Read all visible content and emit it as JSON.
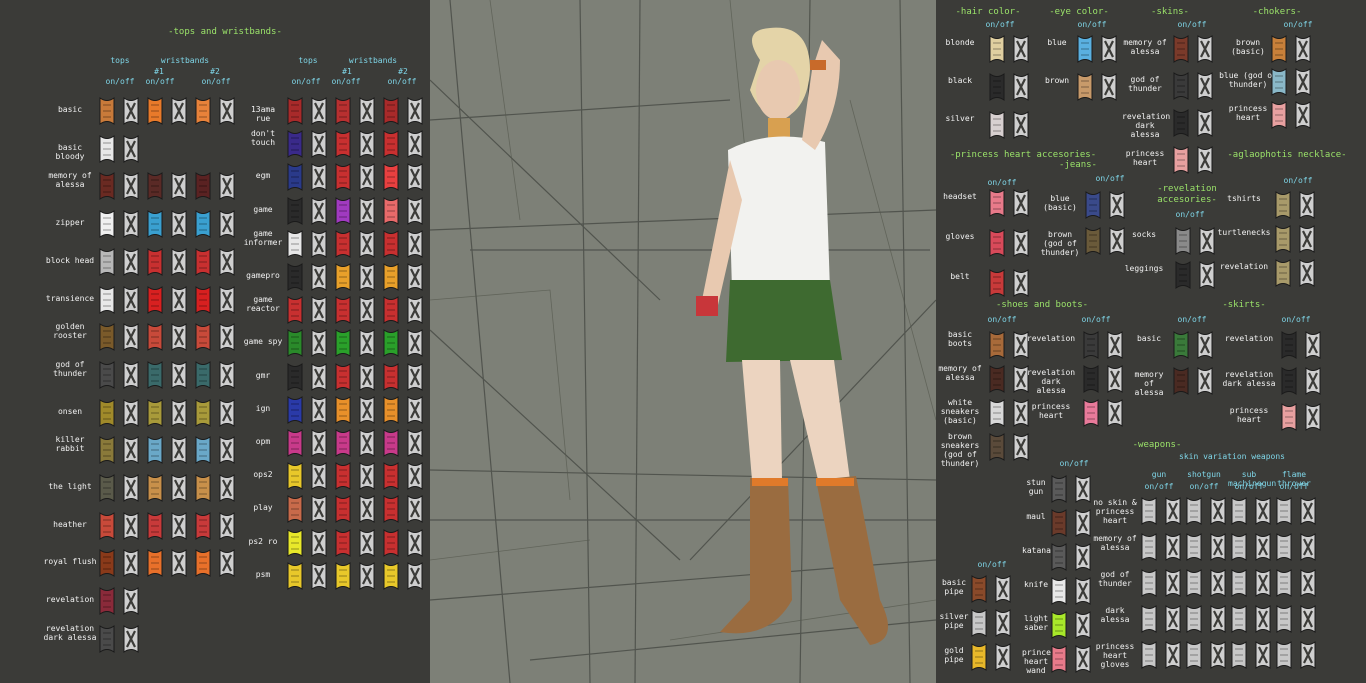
{
  "colors": {
    "panel_bg": "#3b3b38",
    "section_title": "#9be36a",
    "toggle_label": "#7fd6e8",
    "label_text": "#f2f2f2",
    "off_icon": "#d8d8d8",
    "stage_bg": "#7d8077"
  },
  "left": {
    "title": "-tops and wristbands-",
    "col_tops": "tops",
    "col_wristbands": "wristbands",
    "col_w1": "#1",
    "col_w2": "#2",
    "onoff": "on/off",
    "rows_a": [
      {
        "label": "basic",
        "colors": [
          "#c87a3a",
          "#e87a2a",
          "#e8823a"
        ]
      },
      {
        "label": "basic bloody",
        "colors": [
          "#e8e8e8"
        ]
      },
      {
        "label": "memory of alessa",
        "colors": [
          "#6a2a22",
          "#5a2a26",
          "#5a2222"
        ]
      },
      {
        "label": "zipper",
        "colors": [
          "#f0f0f0",
          "#3aa0d0",
          "#3aa0d0"
        ]
      },
      {
        "label": "block head",
        "colors": [
          "#b8b8b8",
          "#c83030",
          "#c83030"
        ]
      },
      {
        "label": "transience",
        "colors": [
          "#e8e8e8",
          "#d82020",
          "#d82020"
        ]
      },
      {
        "label": "golden rooster",
        "colors": [
          "#7a5a2a",
          "#c84a3a",
          "#c84a3a"
        ]
      },
      {
        "label": "god of thunder",
        "colors": [
          "#4a4a4a",
          "#3a6a6a",
          "#3a6a6a"
        ]
      },
      {
        "label": "onsen",
        "colors": [
          "#a08a2a",
          "#a89a3a",
          "#a89a3a"
        ]
      },
      {
        "label": "killer rabbit",
        "colors": [
          "#8a7a3a",
          "#6aa8c8",
          "#6aa8c8"
        ]
      },
      {
        "label": "the light",
        "colors": [
          "#5a5a4a",
          "#c8904a",
          "#c8904a"
        ]
      },
      {
        "label": "heather",
        "colors": [
          "#c84a3a",
          "#c83a3a",
          "#c83a3a"
        ]
      },
      {
        "label": "royal flush",
        "colors": [
          "#8a3a1a",
          "#e8702a",
          "#e8702a"
        ]
      },
      {
        "label": "revelation",
        "colors": [
          "#8a2a3a"
        ]
      },
      {
        "label": "revelation dark alessa",
        "colors": [
          "#4a4a4a"
        ]
      }
    ],
    "rows_b": [
      {
        "label": "13ama rue",
        "colors": [
          "#a82a2a",
          "#b83030",
          "#a82a2a"
        ]
      },
      {
        "label": "don't touch",
        "colors": [
          "#3a2a8a",
          "#c83030",
          "#c83030"
        ]
      },
      {
        "label": "egm",
        "colors": [
          "#2a3a8a",
          "#c83030",
          "#e84040"
        ]
      },
      {
        "label": "game",
        "colors": [
          "#2a2a2a",
          "#a03ac0",
          "#e86a6a"
        ]
      },
      {
        "label": "game informer",
        "colors": [
          "#e8e8e8",
          "#c83030",
          "#c83030"
        ]
      },
      {
        "label": "gamepro",
        "colors": [
          "#2a2a2a",
          "#e8a02a",
          "#e8a02a"
        ]
      },
      {
        "label": "game reactor",
        "colors": [
          "#c83030",
          "#c83030",
          "#c83030"
        ]
      },
      {
        "label": "game spy",
        "colors": [
          "#2a8a2a",
          "#2aa02a",
          "#2aa02a"
        ]
      },
      {
        "label": "gmr",
        "colors": [
          "#2a2a2a",
          "#c83030",
          "#c83030"
        ]
      },
      {
        "label": "ign",
        "colors": [
          "#2a3aa8",
          "#e8902a",
          "#e8902a"
        ]
      },
      {
        "label": "opm",
        "colors": [
          "#c83a8a",
          "#c83a8a",
          "#c83a8a"
        ]
      },
      {
        "label": "ops2",
        "colors": [
          "#e8c82a",
          "#c83030",
          "#c83030"
        ]
      },
      {
        "label": "play",
        "colors": [
          "#c86a4a",
          "#c83030",
          "#c83030"
        ]
      },
      {
        "label": "ps2 ro",
        "colors": [
          "#e8e82a",
          "#c83030",
          "#c83030"
        ]
      },
      {
        "label": "psm",
        "colors": [
          "#e8c82a",
          "#e8c82a",
          "#e8c82a"
        ]
      }
    ]
  },
  "right": {
    "hair_title": "-hair color-",
    "hair": [
      {
        "label": "blonde",
        "color": "#e0cfa0"
      },
      {
        "label": "black",
        "color": "#2a2a2a"
      },
      {
        "label": "silver",
        "color": "#d8d0d0"
      }
    ],
    "eye_title": "-eye color-",
    "eye": [
      {
        "label": "blue",
        "color": "#5ab0e0"
      },
      {
        "label": "brown",
        "color": "#c89a6a"
      }
    ],
    "skins_title": "-skins-",
    "skins": [
      {
        "label": "memory of alessa",
        "color": "#7a3a2a"
      },
      {
        "label": "god of thunder",
        "color": "#3a3a3a"
      },
      {
        "label": "revelation dark alessa",
        "color": "#2a2a2a"
      },
      {
        "label": "princess heart",
        "color": "#e8a0a0"
      }
    ],
    "chokers_title": "-chokers-",
    "chokers": [
      {
        "label": "brown (basic)",
        "color": "#c8803a"
      },
      {
        "label": "blue (god of thunder)",
        "color": "#8ab8c8"
      },
      {
        "label": "princess heart",
        "color": "#e8a0a0"
      }
    ],
    "ph_title": "-princess heart accesories-",
    "ph": [
      {
        "label": "headset",
        "color": "#e87a8a"
      },
      {
        "label": "gloves",
        "color": "#d84a5a"
      },
      {
        "label": "belt",
        "color": "#c83a3a"
      }
    ],
    "jeans_title": "-jeans-",
    "jeans": [
      {
        "label": "blue (basic)",
        "color": "#3a4a8a"
      },
      {
        "label": "brown (god of thunder)",
        "color": "#6a5a3a"
      }
    ],
    "rev_title": "-revelation accesories-",
    "rev": [
      {
        "label": "socks",
        "color": "#8a8a8a"
      },
      {
        "label": "leggings",
        "color": "#2a2a2a"
      }
    ],
    "agl_title": "-aglaophotis necklace-",
    "agl": [
      {
        "label": "tshirts",
        "color": "#a89a6a"
      },
      {
        "label": "turtlenecks",
        "color": "#a89a6a"
      },
      {
        "label": "revelation",
        "color": "#a89a6a"
      }
    ],
    "shoes_title": "-shoes and boots-",
    "shoes_a": [
      {
        "label": "basic boots",
        "color": "#a86a3a"
      },
      {
        "label": "memory of alessa",
        "color": "#4a2a22"
      },
      {
        "label": "white sneakers (basic)",
        "color": "#d8d8d8"
      },
      {
        "label": "brown sneakers (god of thunder)",
        "color": "#5a4a3a"
      }
    ],
    "shoes_b": [
      {
        "label": "revelation",
        "color": "#3a3a3a"
      },
      {
        "label": "revelation dark alessa",
        "color": "#2a2a2a"
      },
      {
        "label": "princess heart",
        "color": "#e87a9a"
      }
    ],
    "skirts_title": "-skirts-",
    "skirts_a": [
      {
        "label": "basic",
        "color": "#3a7a3a"
      },
      {
        "label": "memory of alessa",
        "color": "#4a2a22"
      }
    ],
    "skirts_b": [
      {
        "label": "revelation",
        "color": "#2a2a2a"
      },
      {
        "label": "revelation dark alessa",
        "color": "#2a2a2a"
      },
      {
        "label": "princess heart",
        "color": "#e8a0a0"
      }
    ],
    "weapons_title": "-weapons-",
    "skin_var_title": "skin variation weapons",
    "wcol": [
      "gun",
      "shotgun",
      "sub machinegun",
      "flame thrower"
    ],
    "melee": [
      {
        "label": "stun gun",
        "color": "#5a5a5a"
      },
      {
        "label": "maul",
        "color": "#6a3a2a"
      },
      {
        "label": "katana",
        "color": "#5a5a5a"
      },
      {
        "label": "knife",
        "color": "#e8e8e8"
      },
      {
        "label": "light saber",
        "color": "#a8e82a"
      },
      {
        "label": "princess heart wand",
        "color": "#e87a8a"
      }
    ],
    "pipes": [
      {
        "label": "basic pipe",
        "color": "#8a4a2a"
      },
      {
        "label": "silver pipe",
        "color": "#c8c8c8"
      },
      {
        "label": "gold pipe",
        "color": "#e8b82a"
      }
    ],
    "skinvar": [
      {
        "label": "no skin & princess heart",
        "color": "#c8c8c8"
      },
      {
        "label": "memory of alessa",
        "color": "#c8c8c8"
      },
      {
        "label": "god of thunder",
        "color": "#c8c8c8"
      },
      {
        "label": "dark alessa",
        "color": "#c8c8c8"
      },
      {
        "label": "princess heart gloves",
        "color": "#c8c8c8"
      }
    ]
  }
}
